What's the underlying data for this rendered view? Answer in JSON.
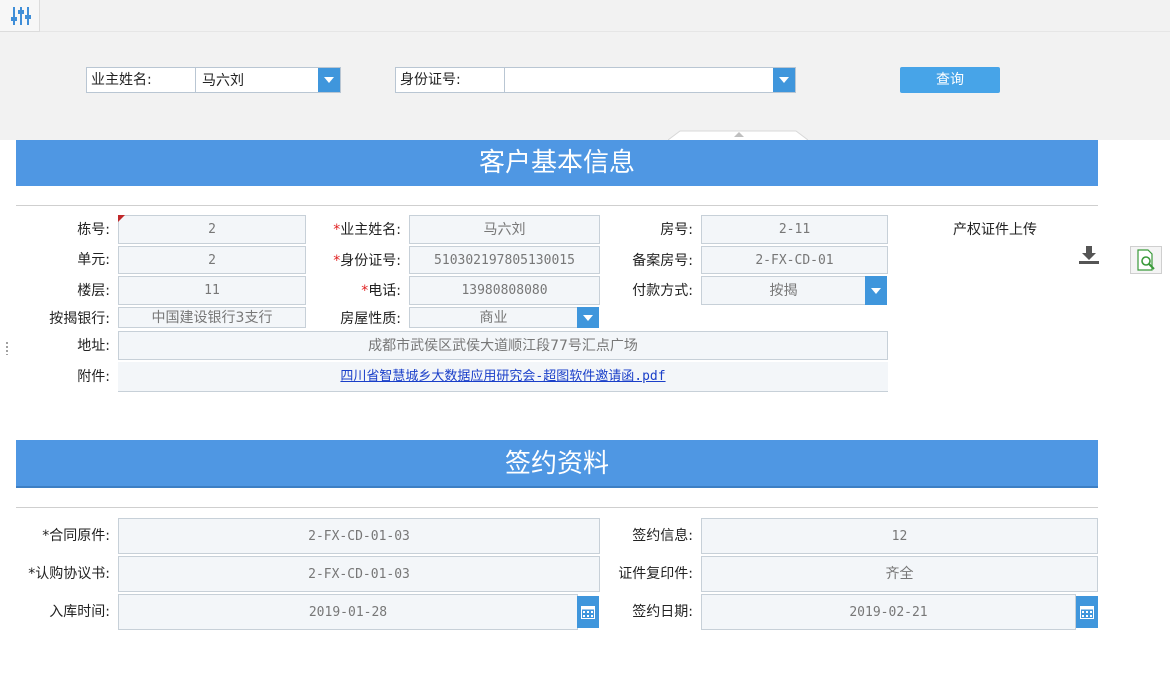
{
  "search": {
    "owner_label": "业主姓名:",
    "owner_value": "马六刘",
    "id_label": "身份证号:",
    "id_value": "",
    "query_button": "查询"
  },
  "sections": {
    "basic_title": "客户基本信息",
    "contract_title": "签约资料"
  },
  "basic": {
    "building_label": "栋号:",
    "building_value": "2",
    "unit_label": "单元:",
    "unit_value": "2",
    "floor_label": "楼层:",
    "floor_value": "11",
    "bank_label": "按揭银行:",
    "bank_value": "中国建设银行3支行",
    "owner_label": "业主姓名:",
    "owner_value": "马六刘",
    "id_label": "身份证号:",
    "id_value": "510302197805130015",
    "phone_label": "电话:",
    "phone_value": "13980808080",
    "prop_type_label": "房屋性质:",
    "prop_type_value": "商业",
    "room_label": "房号:",
    "room_value": "2-11",
    "record_label": "备案房号:",
    "record_value": "2-FX-CD-01",
    "pay_label": "付款方式:",
    "pay_value": "按揭",
    "address_label": "地址:",
    "address_value": "成都市武侯区武侯大道顺江段77号汇点广场",
    "attach_label": "附件:",
    "attach_value": "四川省智慧城乡大数据应用研究会-超图软件邀请函.pdf",
    "upload_label": "产权证件上传",
    "required_mark": "*"
  },
  "contract": {
    "original_label": "合同原件:",
    "original_value": "2-FX-CD-01-03",
    "subscribe_label": "认购协议书:",
    "subscribe_value": "2-FX-CD-01-03",
    "storage_label": "入库时间:",
    "storage_value": "2019-01-28",
    "sign_info_label": "签约信息:",
    "sign_info_value": "12",
    "copy_label": "证件复印件:",
    "copy_value": "齐全",
    "sign_date_label": "签约日期:",
    "sign_date_value": "2019-02-21",
    "required_mark": "*"
  },
  "colors": {
    "banner": "#4f97e3",
    "button": "#47a4e8",
    "dropdown": "#3f96dc",
    "required": "#e02020"
  }
}
